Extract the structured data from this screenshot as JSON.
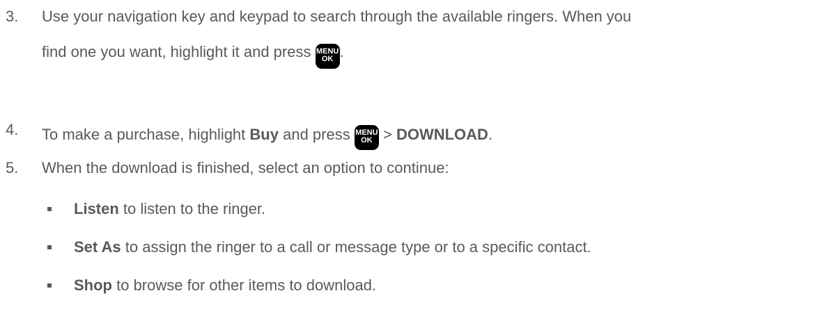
{
  "steps": [
    {
      "number": "3.",
      "line1": "Use your navigation key and keypad to search through the available ringers. When you",
      "line2_text": "find one you want, highlight it and press",
      "line2_tail": "."
    },
    {
      "number": "4.",
      "pre": "To make a purchase, highlight",
      "bold1": "Buy",
      "mid": "and press",
      "gt": ">",
      "bold2": "DOWNLOAD",
      "tail": "."
    },
    {
      "number": "5.",
      "text": "When the download is finished, select an option to continue:"
    }
  ],
  "key": {
    "top": "MENU",
    "bottom": "OK",
    "icon": "menu-ok-key-icon"
  },
  "bullets": [
    {
      "bold": "Listen",
      "rest": " to listen to the ringer."
    },
    {
      "bold": "Set As",
      "rest": " to assign the ringer to a call or message type or to a specific contact."
    },
    {
      "bold": "Shop",
      "rest": " to browse for other items to download."
    }
  ]
}
